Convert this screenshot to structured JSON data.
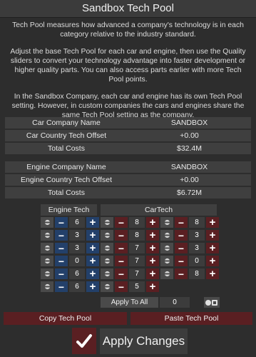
{
  "window": {
    "title": "Sandbox Tech Pool"
  },
  "description": {
    "p1": "Tech Pool measures how advanced a company's technology is in each category relative to the industry standard.",
    "p2": "Adjust the base Tech Pool for each car and engine, then use the Quality sliders to convert your technology advantage into faster development or higher quality parts. You can also access parts earlier with more Tech Pool points.",
    "p3": "In the Sandbox Company, each car and engine has its own Tech Pool setting. However, in custom companies the cars and engines share the same Tech Pool setting as the company."
  },
  "car_company": {
    "rows": [
      {
        "label": "Car Company Name",
        "value": "SANDBOX"
      },
      {
        "label": "Car Country Tech Offset",
        "value": "+0.00"
      },
      {
        "label": "Total Costs",
        "value": "$32.4M"
      }
    ]
  },
  "engine_company": {
    "rows": [
      {
        "label": "Engine Company Name",
        "value": "SANDBOX"
      },
      {
        "label": "Engine Country Tech Offset",
        "value": "+0.00"
      },
      {
        "label": "Total Costs",
        "value": "$6.72M"
      }
    ]
  },
  "engine_tech": {
    "header": "Engine Tech",
    "items": [
      {
        "icon": "engine-block-icon",
        "value": "6"
      },
      {
        "icon": "crankshaft-icon",
        "value": "3"
      },
      {
        "icon": "cylinder-head-icon",
        "value": "3"
      },
      {
        "icon": "aspiration-icon",
        "value": "0"
      },
      {
        "icon": "fuel-pump-icon",
        "value": "6"
      },
      {
        "icon": "exhaust-icon",
        "value": "6"
      }
    ]
  },
  "car_tech": {
    "header": "CarTech",
    "left": [
      {
        "icon": "chassis-icon",
        "value": "8"
      },
      {
        "icon": "car-body-icon",
        "value": "8"
      },
      {
        "icon": "steering-icon",
        "value": "7"
      },
      {
        "icon": "transmission-icon",
        "value": "7"
      },
      {
        "icon": "suspension-icon",
        "value": "7"
      },
      {
        "icon": "interior-icon",
        "value": "5"
      }
    ],
    "right": [
      {
        "icon": "wheel-icon",
        "value": "8"
      },
      {
        "icon": "brake-icon",
        "value": "3"
      },
      {
        "icon": "safety-icon",
        "value": "3"
      },
      {
        "icon": "tire-icon",
        "value": "0"
      },
      {
        "icon": "material-icon",
        "value": "8"
      }
    ]
  },
  "apply_all": {
    "label": "Apply To All",
    "value": "0"
  },
  "buttons": {
    "copy": "Copy Tech Pool",
    "paste": "Paste Tech Pool",
    "apply": "Apply Changes"
  },
  "colors": {
    "engine_accent": "#23406a",
    "car_accent": "#5a1f22",
    "panel": "#3f3f3f",
    "background": "#2d2d2d"
  }
}
